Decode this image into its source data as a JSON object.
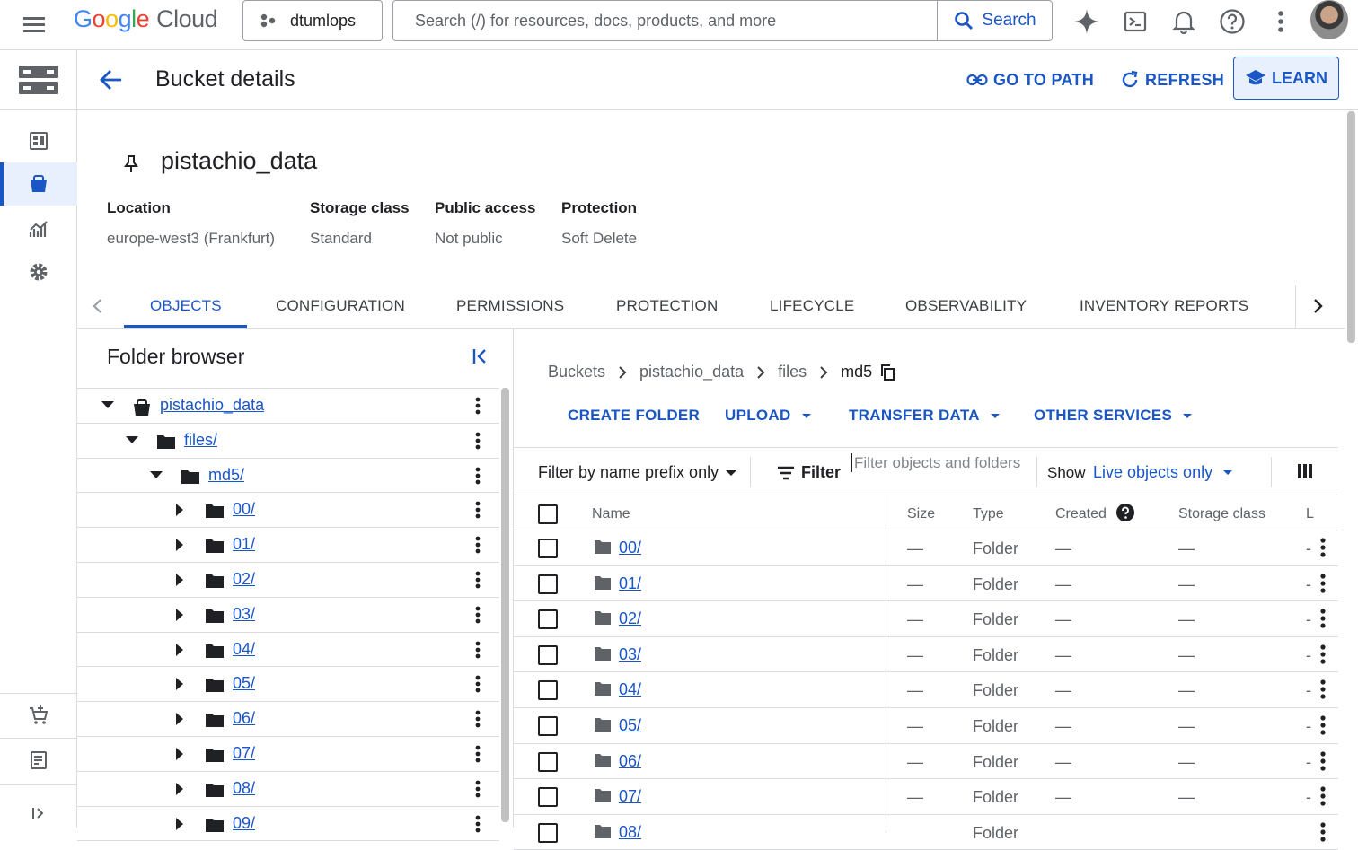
{
  "topbar": {
    "logo": {
      "g": "G",
      "o1": "o",
      "o2": "o",
      "g2": "g",
      "l": "l",
      "e": "e",
      "cloud": "Cloud"
    },
    "project": "dtumlops",
    "search_placeholder": "Search (/) for resources, docs, products, and more",
    "search_button": "Search"
  },
  "header": {
    "title": "Bucket details",
    "go_to_path": "GO TO PATH",
    "refresh": "REFRESH",
    "learn": "LEARN"
  },
  "bucket": {
    "name": "pistachio_data",
    "meta": [
      {
        "key": "Location",
        "value": "europe-west3 (Frankfurt)"
      },
      {
        "key": "Storage class",
        "value": "Standard"
      },
      {
        "key": "Public access",
        "value": "Not public"
      },
      {
        "key": "Protection",
        "value": "Soft Delete"
      }
    ]
  },
  "tabs": [
    "OBJECTS",
    "CONFIGURATION",
    "PERMISSIONS",
    "PROTECTION",
    "LIFECYCLE",
    "OBSERVABILITY",
    "INVENTORY REPORTS"
  ],
  "folder_browser": {
    "title": "Folder browser",
    "tree": [
      {
        "label": "pistachio_data"
      },
      {
        "label": "files/"
      },
      {
        "label": "md5/"
      },
      {
        "label": "00/"
      },
      {
        "label": "01/"
      },
      {
        "label": "02/"
      },
      {
        "label": "03/"
      },
      {
        "label": "04/"
      },
      {
        "label": "05/"
      },
      {
        "label": "06/"
      },
      {
        "label": "07/"
      },
      {
        "label": "08/"
      },
      {
        "label": "09/"
      }
    ]
  },
  "breadcrumb": [
    "Buckets",
    "pistachio_data",
    "files",
    "md5"
  ],
  "actions": {
    "create_folder": "CREATE FOLDER",
    "upload": "UPLOAD",
    "transfer_data": "TRANSFER DATA",
    "other_services": "OTHER SERVICES"
  },
  "filter_bar": {
    "prefix": "Filter by name prefix only",
    "filter": "Filter",
    "placeholder": "Filter objects and folders",
    "show": "Show",
    "live": "Live objects only"
  },
  "table": {
    "headers": {
      "name": "Name",
      "size": "Size",
      "type": "Type",
      "created": "Created",
      "storage_class": "Storage class",
      "last": "L"
    },
    "rows": [
      {
        "name": "00/",
        "size": "—",
        "type": "Folder",
        "created": "—",
        "storage_class": "—",
        "last": "-"
      },
      {
        "name": "01/",
        "size": "—",
        "type": "Folder",
        "created": "—",
        "storage_class": "—",
        "last": "-"
      },
      {
        "name": "02/",
        "size": "—",
        "type": "Folder",
        "created": "—",
        "storage_class": "—",
        "last": "-"
      },
      {
        "name": "03/",
        "size": "—",
        "type": "Folder",
        "created": "—",
        "storage_class": "—",
        "last": "-"
      },
      {
        "name": "04/",
        "size": "—",
        "type": "Folder",
        "created": "—",
        "storage_class": "—",
        "last": "-"
      },
      {
        "name": "05/",
        "size": "—",
        "type": "Folder",
        "created": "—",
        "storage_class": "—",
        "last": "-"
      },
      {
        "name": "06/",
        "size": "—",
        "type": "Folder",
        "created": "—",
        "storage_class": "—",
        "last": "-"
      },
      {
        "name": "07/",
        "size": "—",
        "type": "Folder",
        "created": "—",
        "storage_class": "—",
        "last": "-"
      },
      {
        "name": "08/",
        "size": "",
        "type": "Folder",
        "created": "",
        "storage_class": "",
        "last": ""
      }
    ]
  },
  "colors": {
    "accent": "#1a56c4",
    "divider": "#dadce0",
    "text_secondary": "#5f6368"
  }
}
